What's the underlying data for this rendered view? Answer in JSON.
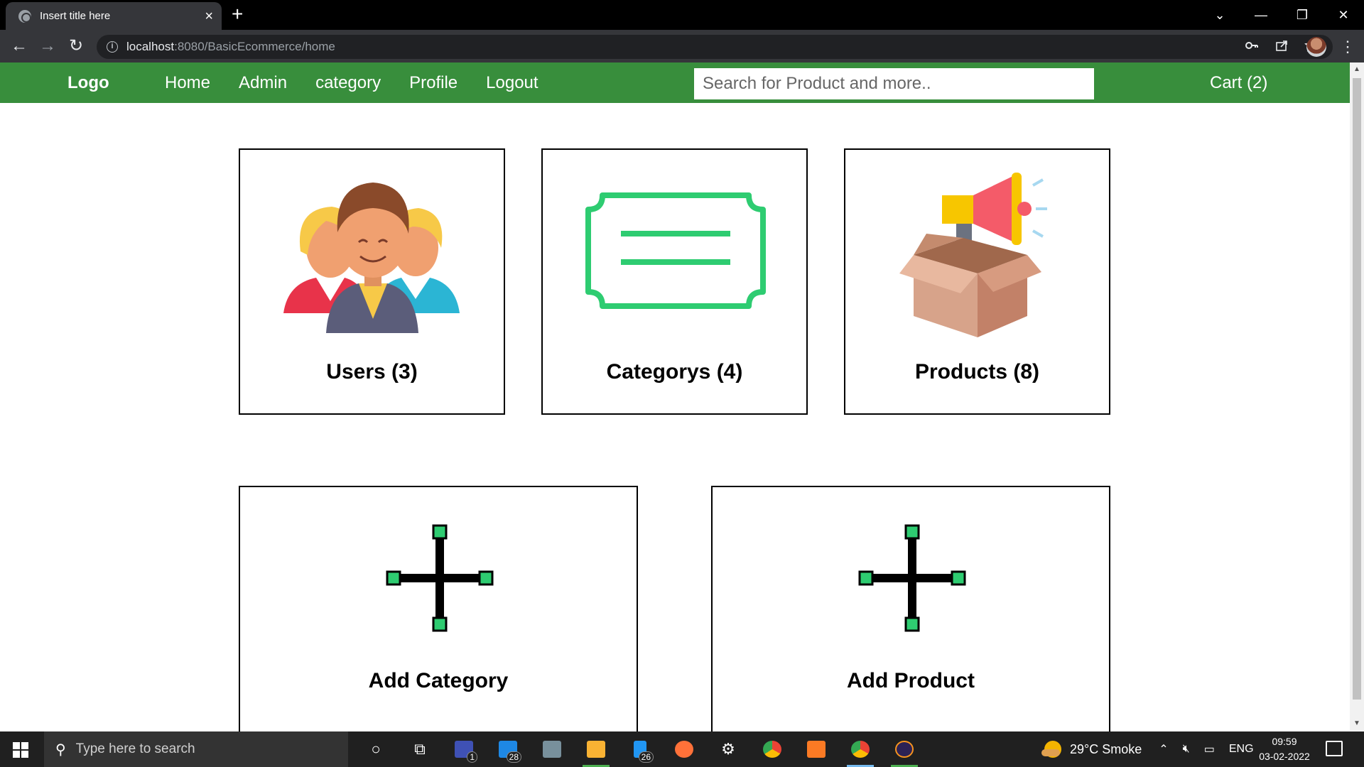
{
  "browser": {
    "tab_title": "Insert title here",
    "tab_close": "×",
    "new_tab": "+",
    "window_controls": [
      "⌄",
      "—",
      "❐",
      "✕"
    ],
    "url_host": "localhost",
    "url_path": ":8080/BasicEcommerce/home",
    "nav": {
      "back": "←",
      "forward": "→",
      "reload": "↻"
    },
    "omni_icons": [
      "key-icon",
      "share-icon",
      "star-icon"
    ],
    "menu": "⋮"
  },
  "header": {
    "logo": "Logo",
    "nav": [
      {
        "label": "Home"
      },
      {
        "label": "Admin"
      },
      {
        "label": "category"
      },
      {
        "label": "Profile"
      },
      {
        "label": "Logout"
      }
    ],
    "search_placeholder": "Search for Product and more..",
    "cart": "Cart (2)",
    "bg_color": "#388e3c"
  },
  "cards": {
    "users": {
      "label": "Users (3)",
      "icon": "users-group-icon"
    },
    "categories": {
      "label": "Categorys (4)",
      "icon": "category-tag-icon"
    },
    "products": {
      "label": "Products (8)",
      "icon": "product-box-megaphone-icon"
    },
    "add_category": {
      "label": "Add Category",
      "icon": "add-plus-icon"
    },
    "add_product": {
      "label": "Add Product",
      "icon": "add-plus-icon"
    }
  },
  "taskbar": {
    "search_placeholder": "Type here to search",
    "mail_badge": "28",
    "phone_badge": "26",
    "app_badge": "1",
    "weather": "29°C  Smoke",
    "lang": "ENG",
    "time": "09:59",
    "date": "03-02-2022"
  }
}
